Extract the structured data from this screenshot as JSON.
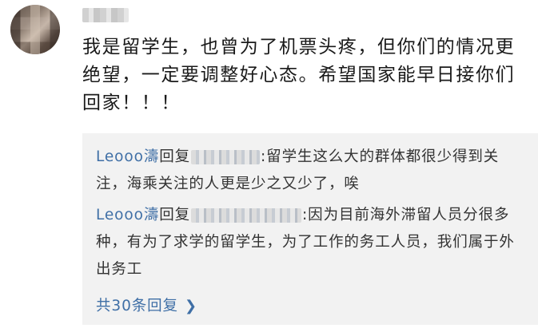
{
  "comment": {
    "text": "我是留学生，也曾为了机票头疼，但你们的情况更绝望，一定要调整好心态。希望国家能早日接你们回家！！！"
  },
  "replies": [
    {
      "author": "Leooo濤",
      "verb": "回复",
      "text": ":留学生这么大的群体都很少得到关注，海乘关注的人更是少之又少了，唉"
    },
    {
      "author": "Leooo濤",
      "verb": "回复",
      "text": ":因为目前海外滞留人员分很多种，有为了求学的留学生，为了工作的务工人员，我们属于外出务工"
    }
  ],
  "view_all": {
    "label": "共30条回复",
    "icon": "chevron-right-icon"
  },
  "colors": {
    "link": "#3f6fa6",
    "text": "#1a1a1a",
    "reply_bg": "#f2f2f2"
  }
}
